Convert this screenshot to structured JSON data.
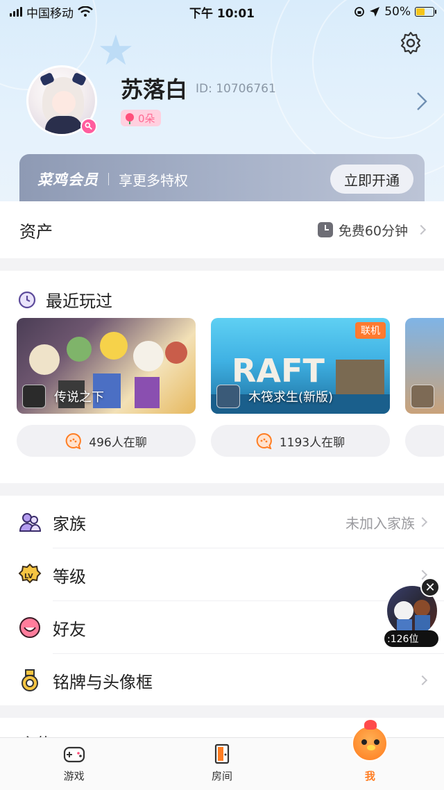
{
  "status_bar": {
    "carrier": "中国移动",
    "time": "下午 10:01",
    "battery": "50%",
    "battery_level": 0.5
  },
  "profile": {
    "name": "苏落白",
    "id_text": "ID: 10706761",
    "flowers": "0朵"
  },
  "vip": {
    "logo": "菜鸡会员",
    "desc": "享更多特权",
    "button": "立即开通"
  },
  "assets": {
    "title": "资产",
    "free_time": "免费60分钟"
  },
  "recent": {
    "title": "最近玩过",
    "games": [
      {
        "name": "传说之下",
        "chat": "496人在聊",
        "tag": "",
        "color1": "#3b3444",
        "color2": "#f2d7a3"
      },
      {
        "name": "木筏求生(新版)",
        "chat": "1193人在聊",
        "tag": "联机",
        "color1": "#4ec1e8",
        "color2": "#1e6c9a"
      }
    ]
  },
  "menu": {
    "items": [
      {
        "label": "家族",
        "value": "未加入家族",
        "icon": "family-icon"
      },
      {
        "label": "等级",
        "value": "",
        "icon": "level-icon"
      },
      {
        "label": "好友",
        "value": "",
        "icon": "friends-icon"
      },
      {
        "label": "铭牌与头像框",
        "value": "",
        "icon": "badge-frame-icon"
      }
    ],
    "partial_label": "主使"
  },
  "floating": {
    "rank": ":126位"
  },
  "tabs": [
    {
      "label": "游戏",
      "icon": "gamepad-icon"
    },
    {
      "label": "房间",
      "icon": "door-icon"
    },
    {
      "label": "我",
      "icon": "chicken-mascot-icon"
    }
  ],
  "colors": {
    "accent": "#ff7d22",
    "vip_start": "#8e9ab4",
    "header_bg": "#d9ecfb"
  }
}
